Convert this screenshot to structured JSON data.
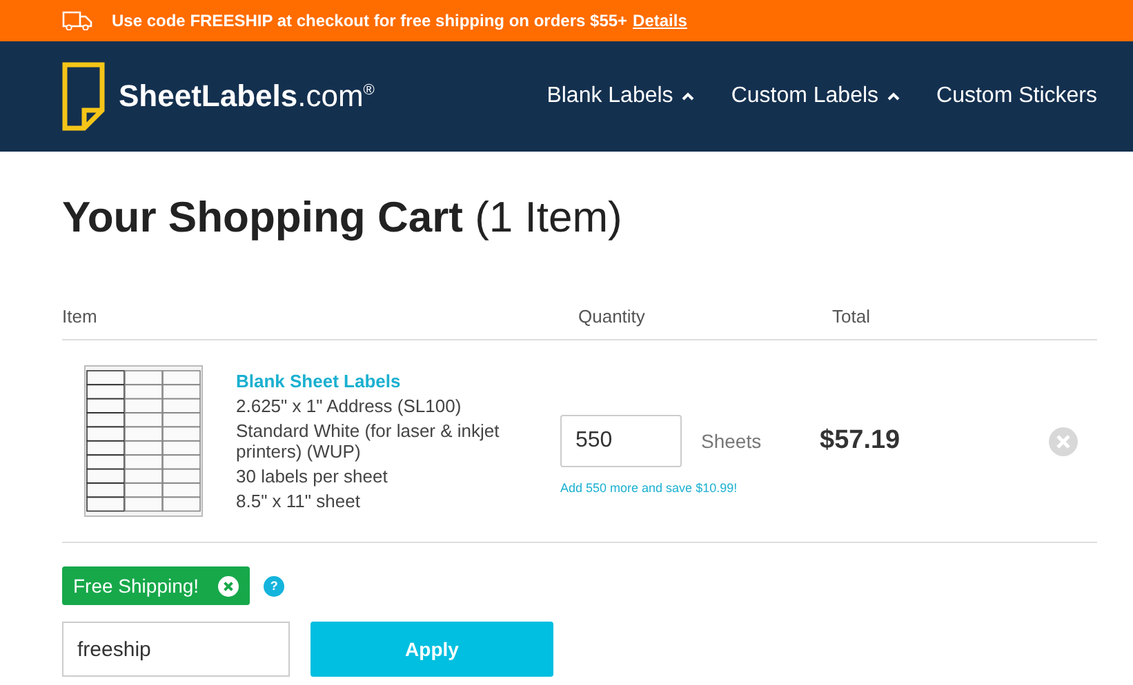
{
  "promo_bar": {
    "text": "Use code FREESHIP at checkout for free shipping on orders $55+",
    "link": "Details"
  },
  "header": {
    "logo": "**SheetLabels**.com$^{®}$",
    "nav": [
      {
        "label": "Blank Labels",
        "has_caret": true
      },
      {
        "label": "Custom Labels",
        "has_caret": true
      },
      {
        "label": "Custom Stickers",
        "has_caret": false
      }
    ]
  },
  "heading": "**Your Shopping Cart** (1 Item)",
  "table": {
    "columns": [
      "Item",
      "Quantity",
      "Total"
    ],
    "rows": [
      {
        "name": "Blank Sheet Labels",
        "details": [
          "2.625\" x 1\" Address (SL100)",
          "Standard White (for laser & inkjet printers) (WUP)",
          "30 labels per sheet",
          "8.5\" x 11\" sheet"
        ],
        "quantity": "550",
        "unit": "Sheets",
        "upsell": "Add 550 more and save $10.99!",
        "total": "$57.19"
      }
    ]
  },
  "coupon": {
    "applied": "Free Shipping!",
    "help": "?",
    "value": "freeship",
    "button": "Apply"
  }
}
